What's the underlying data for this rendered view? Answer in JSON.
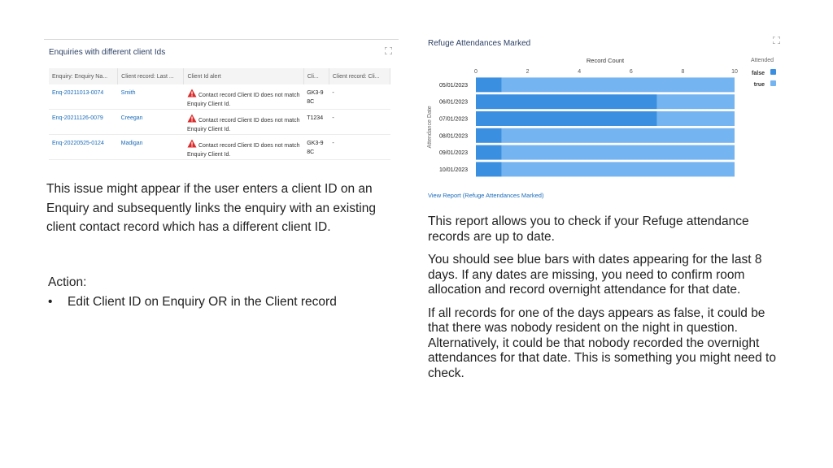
{
  "enquiries_panel": {
    "title": "Enquiries with different client Ids",
    "expand_icon": "expand-icon",
    "columns": [
      "Enquiry: Enquiry Na...",
      "Client record: Last ...",
      "Client Id alert",
      "Cli...",
      "Client record: Cli..."
    ],
    "rows": [
      {
        "enquiry": "Enq-20211013-0074",
        "last_name": "Smith",
        "alert": "Contact record Client ID does not match Enquiry Client Id.",
        "client_id": "GK3-98C",
        "client_record": "-"
      },
      {
        "enquiry": "Enq-20211126-0079",
        "last_name": "Creegan",
        "alert": "Contact record Client ID does not match Enquiry Client Id.",
        "client_id": "T1234",
        "client_record": "-"
      },
      {
        "enquiry": "Enq-20220525-0124",
        "last_name": "Madigan",
        "alert": "Contact record Client ID does not match Enquiry Client Id.",
        "client_id": "GK3-98C",
        "client_record": "-"
      }
    ],
    "warning_icon": "warning-triangle-icon",
    "warning_color": "#d92b2b"
  },
  "left_description": "This issue might appear if the user enters a client ID on an Enquiry and subsequently links the enquiry with an existing client contact record which has a different client ID.",
  "action": {
    "label": "Action:",
    "bullet": "•",
    "item": "Edit Client ID on Enquiry OR in the Client record"
  },
  "refuge_panel": {
    "title": "Refuge Attendances Marked",
    "expand_icon": "expand-icon",
    "view_report": "View Report (Refuge Attendances Marked)"
  },
  "chart_data": {
    "type": "bar",
    "orientation": "horizontal",
    "stacked": true,
    "xlabel": "Record Count",
    "ylabel": "Attendance Date",
    "xlim": [
      0,
      10
    ],
    "x_ticks": [
      "0",
      "2",
      "4",
      "6",
      "8",
      "10"
    ],
    "categories": [
      "05/01/2023",
      "06/01/2023",
      "07/01/2023",
      "08/01/2023",
      "09/01/2023",
      "10/01/2023"
    ],
    "legend_title": "Attended",
    "legend_position": "top-right",
    "series": [
      {
        "name": "false",
        "color": "#3a8fe0",
        "values": [
          1,
          7,
          7,
          1,
          1,
          1
        ]
      },
      {
        "name": "true",
        "color": "#74b4f1",
        "values": [
          9,
          3,
          3,
          9,
          9,
          9
        ]
      }
    ]
  },
  "right_paragraphs": [
    "This report allows you to check if your Refuge attendance records are up to date.",
    "You should see blue bars with dates appearing for the last 8 days. If any dates are missing, you need to confirm room allocation and record overnight attendance for that date.",
    "If all records for one of the days appears as false, it could be that there was nobody resident on the night in question. Alternatively, it could be that nobody recorded the overnight attendances for that date. This is something you might need to check."
  ]
}
